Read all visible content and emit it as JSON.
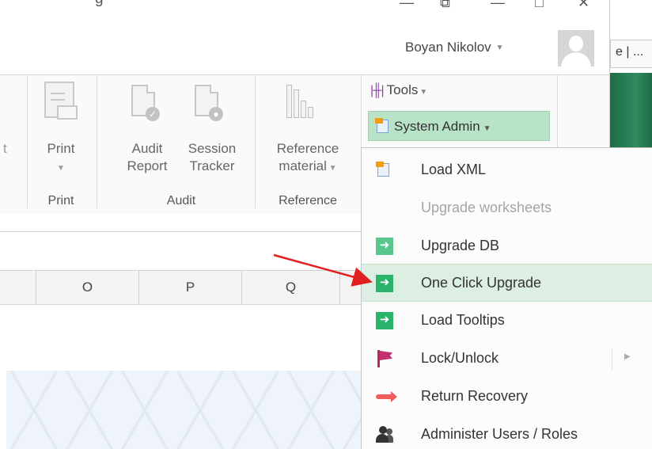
{
  "window": {
    "partial_title_text": "g",
    "account_name": "Boyan Nikolov",
    "background_tab_title": "e | ...",
    "controls": {
      "minimize": "—",
      "restore": "⧉",
      "maximize": "□",
      "close": "✕"
    }
  },
  "ribbon": {
    "clipped_label": "t",
    "print": {
      "label": "Print",
      "group": "Print"
    },
    "audit_report": {
      "line1": "Audit",
      "line2": "Report"
    },
    "session_tracker": {
      "line1": "Session",
      "line2": "Tracker"
    },
    "audit_group": "Audit",
    "reference_material": {
      "line1": "Reference",
      "line2": "material"
    },
    "reference_group": "Reference",
    "tools": {
      "label": "Tools",
      "icon": "equalizer-icon"
    },
    "system_admin": {
      "label": "System Admin",
      "icon": "xml-document-icon"
    }
  },
  "grid": {
    "columns": [
      "O",
      "P",
      "Q"
    ]
  },
  "menu": {
    "items": [
      {
        "label": "Load XML",
        "icon": "xml-document-icon",
        "enabled": true,
        "highlighted": false
      },
      {
        "label": "Upgrade worksheets",
        "icon": "",
        "enabled": false,
        "highlighted": false
      },
      {
        "label": "Upgrade DB",
        "icon": "green-arrow-icon",
        "enabled": true,
        "highlighted": false
      },
      {
        "label": "One Click Upgrade",
        "icon": "green-arrow-icon",
        "enabled": true,
        "highlighted": true
      },
      {
        "label": "Load Tooltips",
        "icon": "green-arrow-icon",
        "enabled": true,
        "highlighted": false
      },
      {
        "label": "Lock/Unlock",
        "icon": "flag-icon",
        "enabled": true,
        "highlighted": false,
        "has_submenu": true
      },
      {
        "label": "Return Recovery",
        "icon": "red-arrow-icon",
        "enabled": true,
        "highlighted": false
      },
      {
        "label": "Administer Users / Roles",
        "icon": "users-icon",
        "enabled": true,
        "highlighted": false
      }
    ],
    "submenu_arrow": "▶"
  },
  "colors": {
    "menu_highlight": "#dcefe2",
    "system_admin_active": "#b8e3c6",
    "annotation_arrow": "#e02020",
    "icon_green": "#2bb36b",
    "flag_magenta": "#c2306e"
  }
}
